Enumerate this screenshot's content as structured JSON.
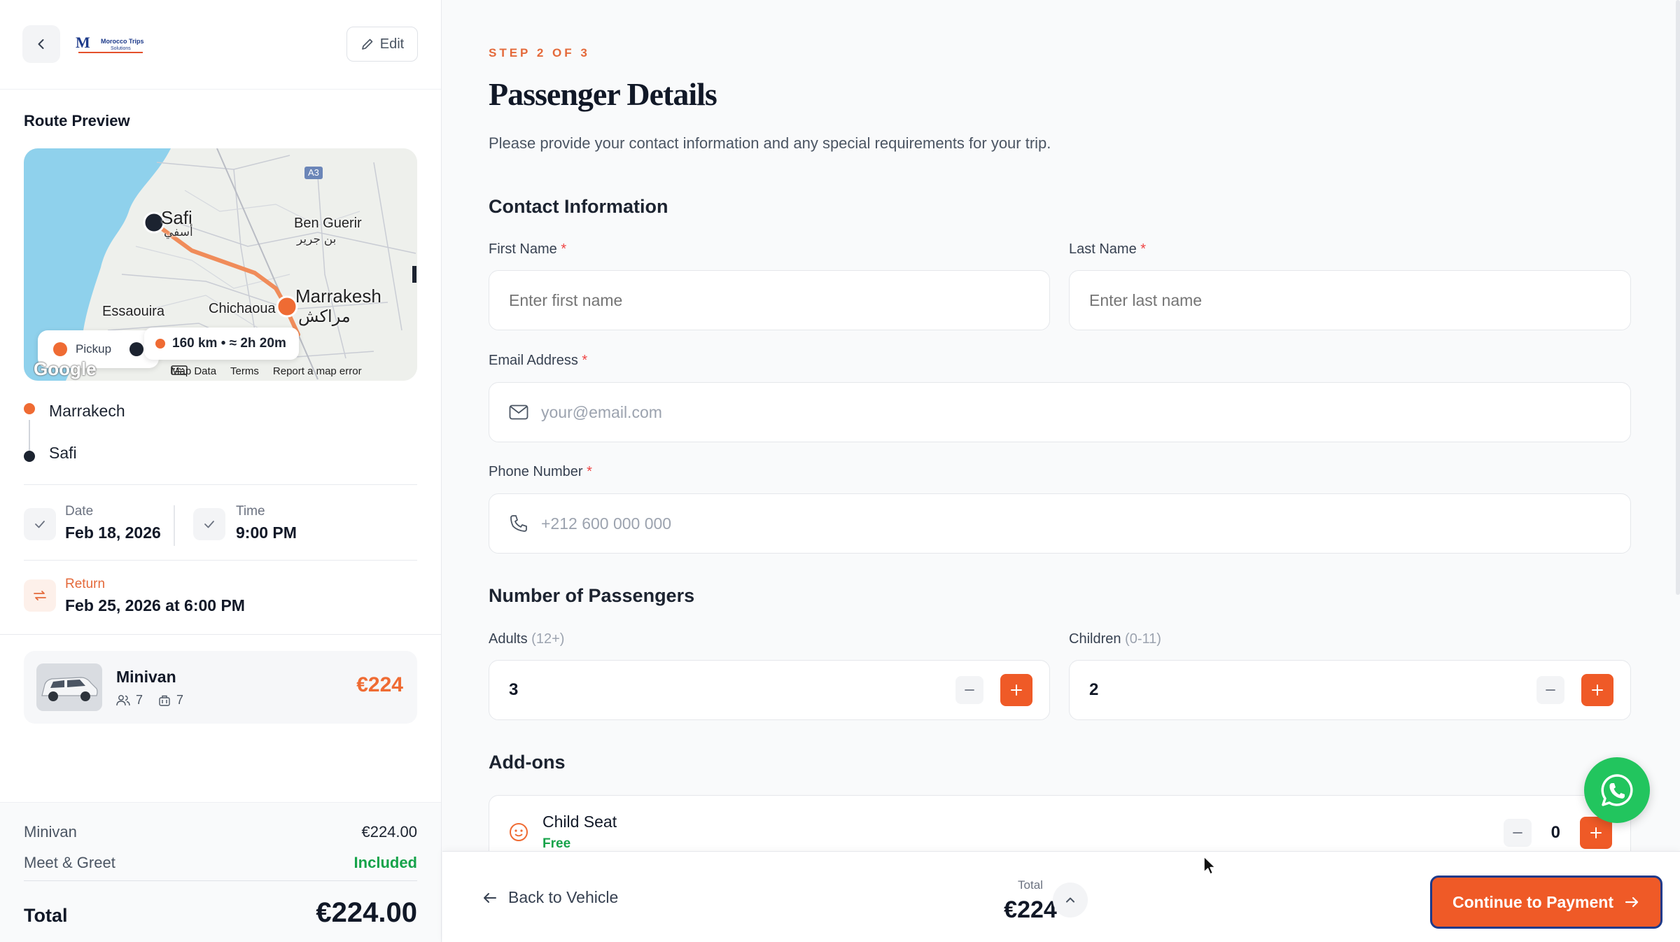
{
  "sidebar": {
    "brand_line1": "Morocco Trips",
    "brand_line2": "Solutions",
    "edit_label": "Edit",
    "route_title": "Route Preview",
    "map": {
      "labels": {
        "safi": "Safi",
        "safi_ar": "أسفي",
        "ben_guerir": "Ben Guerir",
        "ben_guerir_ar": "بن جرير",
        "marrakesh": "Marrakesh",
        "marrakesh_ar": "مراكش",
        "essaouira": "Essaouira",
        "chichaoua": "Chichaoua",
        "road": "A3"
      },
      "legend_pickup": "Pickup",
      "distance": "160 km • ≈ 2h 20m",
      "footer": [
        "Map Data",
        "Terms",
        "Report a map error"
      ],
      "google": "Google"
    },
    "stops": {
      "pickup": "Marrakech",
      "dropoff": "Safi"
    },
    "date": {
      "label": "Date",
      "value": "Feb 18, 2026"
    },
    "time": {
      "label": "Time",
      "value": "9:00 PM"
    },
    "return": {
      "label": "Return",
      "value": "Feb 25, 2026 at 6:00 PM"
    },
    "vehicle": {
      "name": "Minivan",
      "passengers": "7",
      "luggage": "7",
      "price": "€224"
    },
    "summary": {
      "rows": [
        {
          "label": "Minivan",
          "value": "€224.00"
        },
        {
          "label": "Meet & Greet",
          "value": "Included"
        }
      ],
      "total_label": "Total",
      "total_value": "€224.00"
    }
  },
  "main": {
    "step": "STEP 2 OF 3",
    "title": "Passenger Details",
    "subtitle": "Please provide your contact information and any special requirements for your trip.",
    "contact": {
      "heading": "Contact Information",
      "first_name": {
        "label": "First Name",
        "placeholder": "Enter first name"
      },
      "last_name": {
        "label": "Last Name",
        "placeholder": "Enter last name"
      },
      "email": {
        "label": "Email Address",
        "placeholder": "your@email.com"
      },
      "phone": {
        "label": "Phone Number",
        "placeholder": "+212 600 000 000"
      },
      "required_mark": "*"
    },
    "passengers": {
      "heading": "Number of Passengers",
      "adults": {
        "label": "Adults",
        "hint": "(12+)",
        "value": "3"
      },
      "children": {
        "label": "Children",
        "hint": "(0-11)",
        "value": "2"
      }
    },
    "addons": {
      "heading": "Add-ons",
      "items": [
        {
          "name": "Child Seat",
          "price": "Free",
          "qty": "0"
        }
      ]
    },
    "footer": {
      "back_label": "Back to Vehicle",
      "total_label": "Total",
      "total_value": "€224",
      "continue_label": "Continue to Payment"
    }
  },
  "colors": {
    "accent": "#ef5a27",
    "accent_text": "#e4693a",
    "success": "#16a34a",
    "whatsapp": "#22c55e"
  }
}
